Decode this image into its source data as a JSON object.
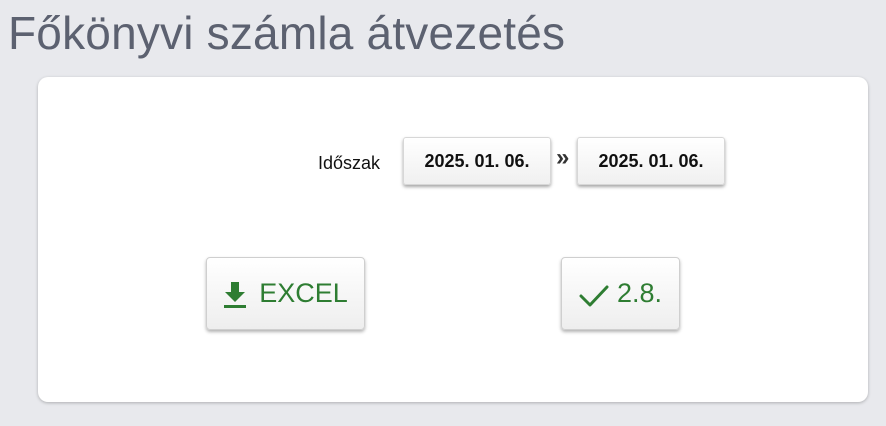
{
  "page": {
    "title": "Főkönyvi számla átvezetés"
  },
  "filter": {
    "period_label": "Időszak",
    "date_from": "2025. 01. 06.",
    "range_separator": "»",
    "date_to": "2025. 01. 06."
  },
  "actions": {
    "excel_label": "EXCEL",
    "excel_icon": "download-icon",
    "ok_label": "2.8.",
    "ok_icon": "checkmark-icon"
  },
  "colors": {
    "accent": "#2e7d32",
    "background": "#e8e9ed",
    "title": "#5c6170"
  }
}
